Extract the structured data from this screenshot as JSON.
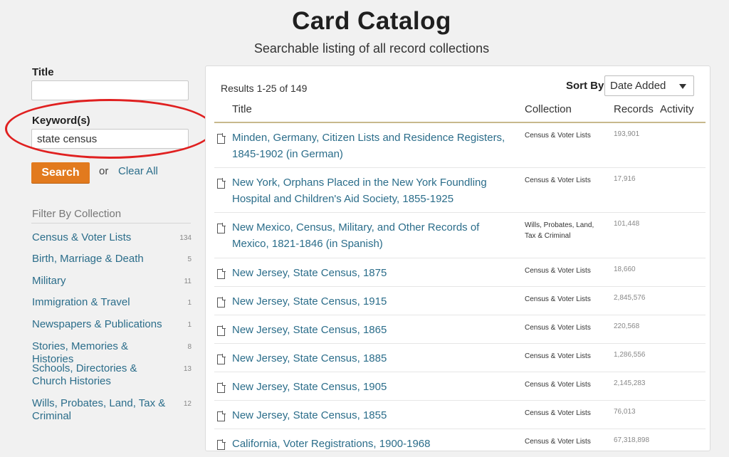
{
  "header": {
    "title": "Card Catalog",
    "subtitle": "Searchable listing of all record collections"
  },
  "search_form": {
    "title_label": "Title",
    "title_value": "",
    "keyword_label": "Keyword(s)",
    "keyword_value": "state census",
    "search_button": "Search",
    "or_text": "or",
    "clear_all": "Clear All",
    "highlight_color": "#e02020",
    "search_button_color": "#e27a1e"
  },
  "filters": {
    "title": "Filter By Collection",
    "items": [
      {
        "label": "Census & Voter Lists",
        "count": "134"
      },
      {
        "label": "Birth, Marriage & Death",
        "count": "5"
      },
      {
        "label": "Military",
        "count": "11"
      },
      {
        "label": "Immigration & Travel",
        "count": "1"
      },
      {
        "label": "Newspapers & Publications",
        "count": "1"
      },
      {
        "label": "Stories, Memories & Histories",
        "count": "8"
      },
      {
        "label": "Schools, Directories & Church Histories",
        "count": "13"
      },
      {
        "label": "Wills, Probates, Land, Tax & Criminal",
        "count": "12"
      }
    ]
  },
  "results": {
    "count_text": "Results 1-25 of 149",
    "sort_label": "Sort By",
    "sort_value": "Date Added",
    "columns": {
      "title": "Title",
      "collection": "Collection",
      "records": "Records",
      "activity": "Activity"
    },
    "link_color": "#2b6d8a",
    "rows": [
      {
        "title": "Minden, Germany, Citizen Lists and Residence Registers, 1845-1902 (in German)",
        "collection": "Census & Voter Lists",
        "records": "193,901"
      },
      {
        "title": "New York, Orphans Placed in the New York Foundling Hospital and Children's Aid Society, 1855-1925",
        "collection": "Census & Voter Lists",
        "records": "17,916"
      },
      {
        "title": "New Mexico, Census, Military, and Other Records of Mexico, 1821-1846 (in Spanish)",
        "collection": "Wills, Probates, Land, Tax & Criminal",
        "records": "101,448"
      },
      {
        "title": "New Jersey, State Census, 1875",
        "collection": "Census & Voter Lists",
        "records": "18,660"
      },
      {
        "title": "New Jersey, State Census, 1915",
        "collection": "Census & Voter Lists",
        "records": "2,845,576"
      },
      {
        "title": "New Jersey, State Census, 1865",
        "collection": "Census & Voter Lists",
        "records": "220,568"
      },
      {
        "title": "New Jersey, State Census, 1885",
        "collection": "Census & Voter Lists",
        "records": "1,286,556"
      },
      {
        "title": "New Jersey, State Census, 1905",
        "collection": "Census & Voter Lists",
        "records": "2,145,283"
      },
      {
        "title": "New Jersey, State Census, 1855",
        "collection": "Census & Voter Lists",
        "records": "76,013"
      },
      {
        "title": "California, Voter Registrations, 1900-1968",
        "collection": "Census & Voter Lists",
        "records": "67,318,898"
      }
    ]
  }
}
